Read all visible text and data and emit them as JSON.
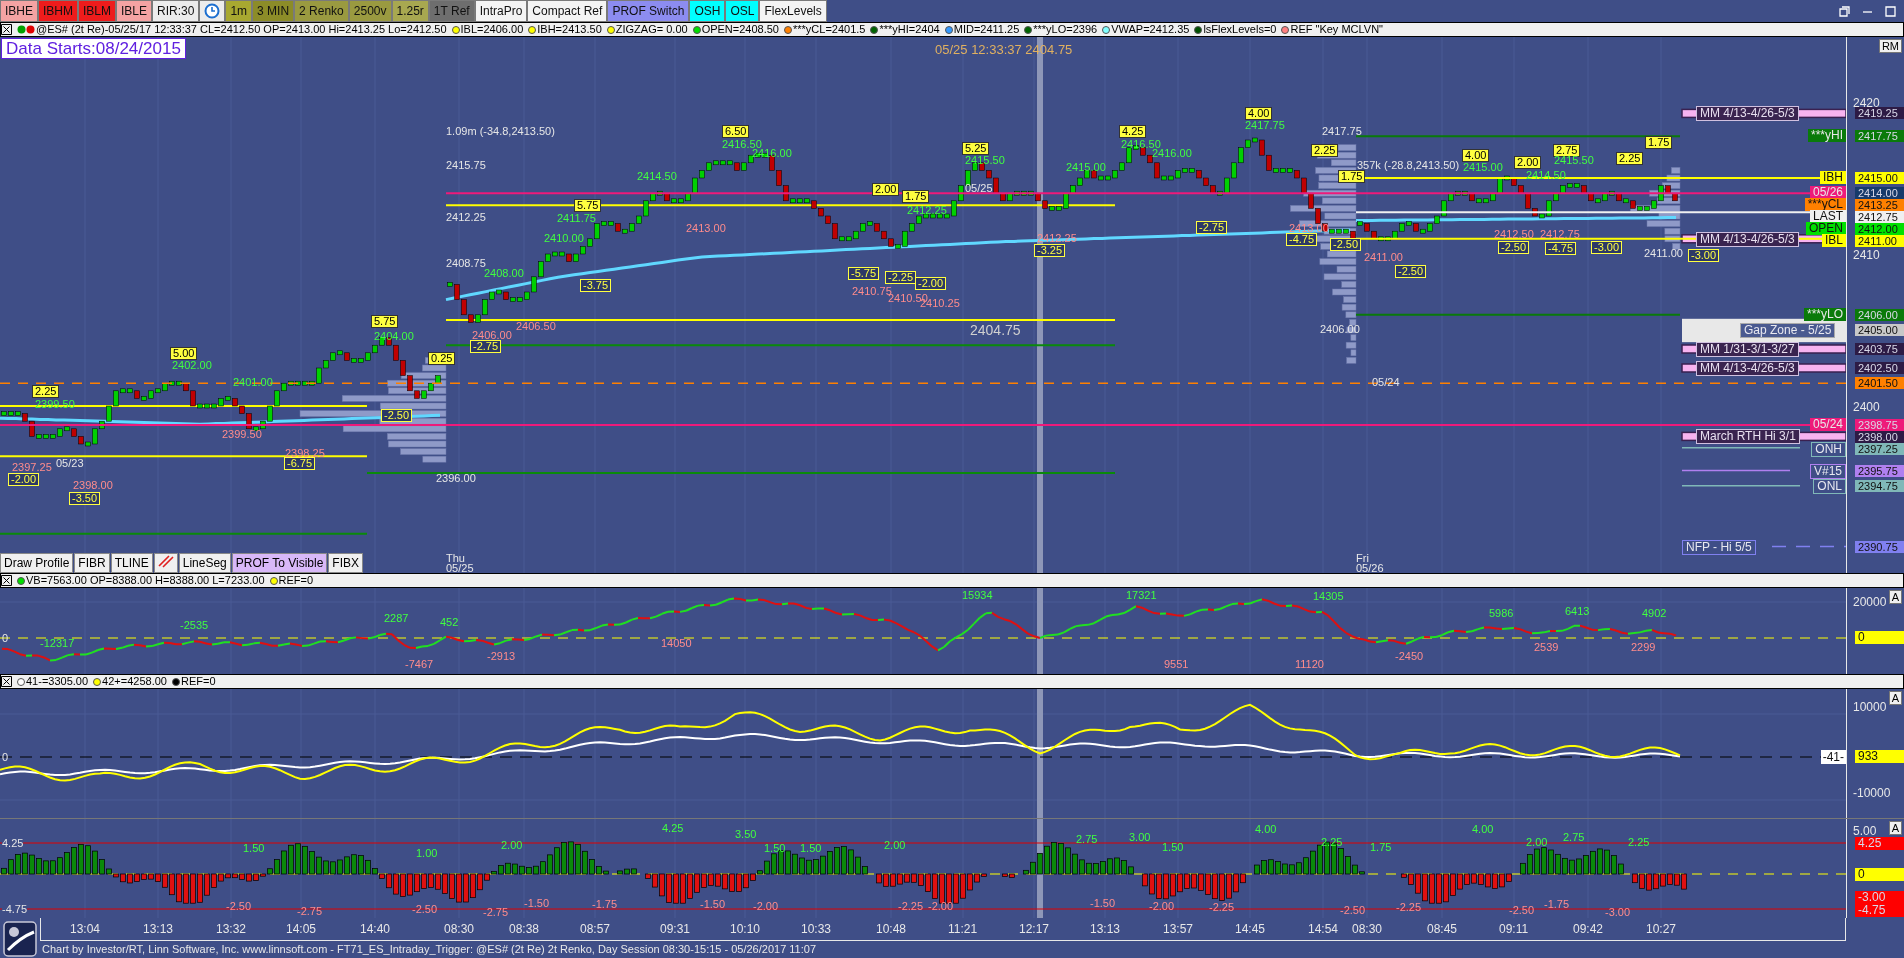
{
  "toolbar": {
    "buttons": [
      {
        "kind": "text",
        "label": "IBHE",
        "color": "#f4a3a3"
      },
      {
        "kind": "text",
        "label": "IBHM",
        "color": "#ee1c1c"
      },
      {
        "kind": "text",
        "label": "IBLM",
        "color": "#ee1c1c"
      },
      {
        "kind": "text",
        "label": "IBLE",
        "color": "#f4a3a3"
      },
      {
        "kind": "text",
        "label": "RIR:30",
        "color": "#ececec"
      },
      {
        "kind": "clock",
        "color": "#ececec"
      },
      {
        "kind": "text",
        "label": "1m",
        "color": "#a8a830"
      },
      {
        "kind": "text",
        "label": "3 MIN",
        "color": "#8c8c28"
      },
      {
        "kind": "text",
        "label": "2 Renko",
        "color": "#9a9a40"
      },
      {
        "kind": "text",
        "label": "2500v",
        "color": "#9a9a40"
      },
      {
        "kind": "text",
        "label": "1.25r",
        "color": "#a8a850"
      },
      {
        "kind": "text",
        "label": "1T Ref",
        "color": "#6e6e6e"
      },
      {
        "kind": "text",
        "label": "IntraPro",
        "color": "#f4f4f4"
      },
      {
        "kind": "text",
        "label": "Compact Ref",
        "color": "#f4f4f4"
      },
      {
        "kind": "text",
        "label": "PROF Switch",
        "color": "#8c8cf0"
      },
      {
        "kind": "text",
        "label": "OSH",
        "color": "#00ffff"
      },
      {
        "kind": "text",
        "label": "OSL",
        "color": "#00ffff"
      },
      {
        "kind": "text",
        "label": "FlexLevels",
        "color": "#f4f4f4"
      }
    ]
  },
  "price_chart": {
    "legend": {
      "title": "@ES# (2t Re)-05/25/17 12:33:37 CL=2412.50 OP=2413.00 Hi=2413.25 Lo=2412.50",
      "items": [
        {
          "text": "IBL=2406.00",
          "color": "#ffff00"
        },
        {
          "text": "IBH=2413.50",
          "color": "#ffff00"
        },
        {
          "text": "ZIGZAG= 0.00",
          "color": "#ffff00"
        },
        {
          "text": "OPEN=2408.50",
          "color": "#00e000"
        },
        {
          "text": "***yCL=2401.5",
          "color": "#ff8000"
        },
        {
          "text": "***yHI=2404",
          "color": "#006400"
        },
        {
          "text": "MID=2411.25",
          "color": "#3399ff"
        },
        {
          "text": "***yLO=2396",
          "color": "#006400"
        },
        {
          "text": "VWAP=2412.35",
          "color": "#80ffff"
        },
        {
          "text": "lsFlexLevels=0",
          "color": "#005000"
        },
        {
          "text": "REF \"Key MCLVN\"",
          "color": "#ff8080"
        }
      ]
    },
    "data_starts": "Data Starts:08/24/2015",
    "cursor_readout": "05/25 12:33:37 2404.75",
    "axis_button": "RM",
    "axis_ticks": [
      "2420",
      "2410",
      "2400"
    ],
    "date_labels": [
      {
        "day": "Thu",
        "date": "05/25"
      },
      {
        "day": "Fri",
        "date": "05/26"
      }
    ],
    "labels": [
      {
        "text": "1.09m (-34.8,2413.50)",
        "kind": "plain"
      },
      {
        "text": "2415.75",
        "kind": "plain"
      },
      {
        "text": "2412.25",
        "kind": "plain"
      },
      {
        "text": "2408.75",
        "kind": "plain"
      },
      {
        "text": "2417.75",
        "kind": "plain"
      },
      {
        "text": "357k (-28.8,2413.50)",
        "kind": "plain"
      },
      {
        "text": "2406.00",
        "kind": "plain"
      },
      {
        "text": "2396.00",
        "kind": "plain"
      },
      {
        "text": "2411.00",
        "kind": "plain"
      },
      {
        "text": "05/24",
        "kind": "plain"
      },
      {
        "text": "05/23",
        "kind": "plain"
      },
      {
        "text": "05/25",
        "kind": "plain"
      },
      {
        "text": "2404.75",
        "kind": "big"
      },
      {
        "text": "6.50",
        "kind": "box"
      },
      {
        "text": "5.25",
        "kind": "box"
      },
      {
        "text": "4.25",
        "kind": "box"
      },
      {
        "text": "4.00",
        "kind": "box"
      },
      {
        "text": "5.75",
        "kind": "box"
      },
      {
        "text": "2.00",
        "kind": "box"
      },
      {
        "text": "1.75",
        "kind": "box"
      },
      {
        "text": "2.25",
        "kind": "box"
      },
      {
        "text": "1.75",
        "kind": "box"
      },
      {
        "text": "4.00",
        "kind": "box"
      },
      {
        "text": "2.00",
        "kind": "box"
      },
      {
        "text": "2.75",
        "kind": "box"
      },
      {
        "text": "2.25",
        "kind": "box"
      },
      {
        "text": "1.75",
        "kind": "box"
      },
      {
        "text": "5.75",
        "kind": "box"
      },
      {
        "text": "0.25",
        "kind": "box"
      },
      {
        "text": "5.00",
        "kind": "box"
      },
      {
        "text": "2.25",
        "kind": "box"
      },
      {
        "text": "2416.50",
        "kind": "up"
      },
      {
        "text": "2416.00",
        "kind": "up"
      },
      {
        "text": "2415.50",
        "kind": "up"
      },
      {
        "text": "2416.50",
        "kind": "up"
      },
      {
        "text": "2416.00",
        "kind": "up"
      },
      {
        "text": "2417.75",
        "kind": "up"
      },
      {
        "text": "2415.00",
        "kind": "up"
      },
      {
        "text": "2414.50",
        "kind": "up"
      },
      {
        "text": "2411.75",
        "kind": "up"
      },
      {
        "text": "2410.00",
        "kind": "up"
      },
      {
        "text": "2408.00",
        "kind": "up"
      },
      {
        "text": "2404.00",
        "kind": "up"
      },
      {
        "text": "2402.00",
        "kind": "up"
      },
      {
        "text": "2401.00",
        "kind": "up"
      },
      {
        "text": "2399.50",
        "kind": "up"
      },
      {
        "text": "2415.00",
        "kind": "up"
      },
      {
        "text": "2414.50",
        "kind": "up"
      },
      {
        "text": "2415.50",
        "kind": "up"
      },
      {
        "text": "2412.25",
        "kind": "up"
      },
      {
        "text": "2413.00",
        "kind": "down"
      },
      {
        "text": "2410.75",
        "kind": "down"
      },
      {
        "text": "2410.50",
        "kind": "down"
      },
      {
        "text": "2410.25",
        "kind": "down"
      },
      {
        "text": "2412.25",
        "kind": "down"
      },
      {
        "text": "2406.00",
        "kind": "down"
      },
      {
        "text": "2406.50",
        "kind": "down"
      },
      {
        "text": "2399.50",
        "kind": "down"
      },
      {
        "text": "2398.25",
        "kind": "down"
      },
      {
        "text": "2397.25",
        "kind": "down"
      },
      {
        "text": "2398.00",
        "kind": "down"
      },
      {
        "text": "2411.00",
        "kind": "down"
      },
      {
        "text": "2412.50",
        "kind": "down"
      },
      {
        "text": "2412.75",
        "kind": "down"
      },
      {
        "text": "2413.00",
        "kind": "down"
      },
      {
        "text": "-3.75",
        "kind": "neg"
      },
      {
        "text": "-5.75",
        "kind": "neg"
      },
      {
        "text": "-2.25",
        "kind": "neg"
      },
      {
        "text": "-2.00",
        "kind": "neg"
      },
      {
        "text": "-3.25",
        "kind": "neg"
      },
      {
        "text": "-2.75",
        "kind": "neg"
      },
      {
        "text": "-4.75",
        "kind": "neg"
      },
      {
        "text": "-2.50",
        "kind": "neg"
      },
      {
        "text": "-2.50",
        "kind": "neg"
      },
      {
        "text": "-2.50",
        "kind": "neg"
      },
      {
        "text": "-4.75",
        "kind": "neg"
      },
      {
        "text": "-3.00",
        "kind": "neg"
      },
      {
        "text": "-3.00",
        "kind": "neg"
      },
      {
        "text": "-2.50",
        "kind": "neg"
      },
      {
        "text": "-6.75",
        "kind": "neg"
      },
      {
        "text": "-2.00",
        "kind": "neg"
      },
      {
        "text": "-3.50",
        "kind": "neg"
      },
      {
        "text": "-2.75",
        "kind": "neg"
      }
    ],
    "levels": [
      {
        "kind": "mm",
        "label": "MM 4/13-4/26-5/3",
        "color": "#f7b3f0",
        "tag": {
          "text": "2419.25",
          "color": "#2d1b45"
        }
      },
      {
        "kind": "flag",
        "label": "***yHI",
        "color": "#0a7a0a",
        "tag": {
          "text": "2417.75",
          "color": "#0a7a0a"
        }
      },
      {
        "kind": "flag",
        "label": "IBH",
        "color": "#ffff00",
        "tag": {
          "text": "2415.00",
          "color": "#ffff00"
        }
      },
      {
        "kind": "flag",
        "label": "05/26",
        "color": "#ee1a7a",
        "tag": {
          "text": "2414.00",
          "color": "#173a6a"
        }
      },
      {
        "kind": "flag",
        "label": "***yCL",
        "color": "#ff8000",
        "tag": {
          "text": "2413.25",
          "color": "#ff8000"
        }
      },
      {
        "kind": "flag",
        "label": "LAST",
        "color": "#f0f0f0",
        "tag": {
          "text": "2412.75",
          "color": "#f0f0f0"
        }
      },
      {
        "kind": "flag",
        "label": "OPEN",
        "color": "#00e000",
        "tag": {
          "text": "2412.00",
          "color": "#00e000"
        }
      },
      {
        "kind": "mm",
        "label": "MM 4/13-4/26-5/3",
        "color": "#f7b3f0"
      },
      {
        "kind": "flag",
        "label": "IBL",
        "color": "#ffff00",
        "tag": {
          "text": "2411.00",
          "color": "#ffff00"
        }
      },
      {
        "kind": "flag",
        "label": "***yLO",
        "color": "#0a7a0a",
        "tag": {
          "text": "2406.00",
          "color": "#0a7a0a"
        }
      },
      {
        "kind": "zone",
        "label": "Gap Zone - 5/25",
        "color": "#e8e8e8",
        "tag": {
          "text": "2405.00",
          "color": "#c8c8c8"
        }
      },
      {
        "kind": "mm",
        "label": "MM 1/31-3/1-3/27",
        "color": "#f7b3f0",
        "tag": {
          "text": "2403.75",
          "color": "#2d1b45"
        }
      },
      {
        "kind": "mm",
        "label": "MM 4/13-4/26-5/3",
        "color": "#f7b3f0",
        "tag": {
          "text": "2402.50",
          "color": "#2d1b45"
        }
      },
      {
        "kind": "dashed",
        "tag": {
          "text": "2401.50",
          "color": "#ff8000"
        }
      },
      {
        "kind": "flag",
        "label": "05/24",
        "color": "#ee1a7a",
        "tag": {
          "text": "2398.75",
          "color": "#ee1a7a"
        }
      },
      {
        "kind": "mm",
        "label": "March RTH Hi 3/1",
        "color": "#f7b3f0",
        "tag": {
          "text": "2398.00",
          "color": "#2d1b45"
        }
      },
      {
        "kind": "outline",
        "label": "ONH",
        "tag": {
          "text": "2397.25",
          "color": "#80b8b8"
        }
      },
      {
        "kind": "outline",
        "label": "V#15",
        "tag": {
          "text": "2395.75",
          "color": "#b080f0"
        }
      },
      {
        "kind": "outline",
        "label": "ONL",
        "tag": {
          "text": "2394.75",
          "color": "#80b8b8"
        }
      },
      {
        "kind": "nfp",
        "label": "NFP - Hi 5/5",
        "tag": {
          "text": "2390.75",
          "color": "#8080f0"
        }
      }
    ]
  },
  "drawing_toolbar": {
    "buttons": [
      {
        "kind": "text",
        "label": "Draw Profile",
        "color": "#f0f0f0"
      },
      {
        "kind": "text",
        "label": "FIBR",
        "color": "#f0f0f0"
      },
      {
        "kind": "text",
        "label": "TLINE",
        "color": "#f0f0f0"
      },
      {
        "kind": "pen",
        "color": "#f0f0f0"
      },
      {
        "kind": "text",
        "label": "LineSeg",
        "color": "#f0f0f0"
      },
      {
        "kind": "text",
        "label": "PROF To Visible",
        "color": "#d8b8f8"
      },
      {
        "kind": "text",
        "label": "FIBX",
        "color": "#f0f0f0"
      }
    ]
  },
  "volume_chart": {
    "legend": {
      "items": [
        {
          "text": "VB=7563.00 OP=8388.00 H=8388.00 L=7233.00",
          "color": "#00e000"
        },
        {
          "text": "REF=0",
          "color": "#ffff00"
        }
      ]
    },
    "zero_label": "0",
    "axis_button": "A",
    "axis_ticks": [
      "20000"
    ],
    "zero_tag": "0",
    "labels": [
      {
        "text": "-12317",
        "kind": "up"
      },
      {
        "text": "-2535",
        "kind": "up"
      },
      {
        "text": "2287",
        "kind": "up"
      },
      {
        "text": "452",
        "kind": "up"
      },
      {
        "text": "15934",
        "kind": "up"
      },
      {
        "text": "17321",
        "kind": "up"
      },
      {
        "text": "14305",
        "kind": "up"
      },
      {
        "text": "5986",
        "kind": "up"
      },
      {
        "text": "6413",
        "kind": "up"
      },
      {
        "text": "4902",
        "kind": "up"
      },
      {
        "text": "-7467",
        "kind": "down"
      },
      {
        "text": "-2913",
        "kind": "down"
      },
      {
        "text": "14050",
        "kind": "down"
      },
      {
        "text": "9551",
        "kind": "down"
      },
      {
        "text": "11120",
        "kind": "down"
      },
      {
        "text": "-2450",
        "kind": "down"
      },
      {
        "text": "2539",
        "kind": "down"
      },
      {
        "text": "2299",
        "kind": "down"
      }
    ]
  },
  "oscillator_chart": {
    "legend": {
      "items": [
        {
          "text": "41-=3305.00",
          "color": "#ffffff"
        },
        {
          "text": "42+=4258.00",
          "color": "#ffff00"
        },
        {
          "text": "REF=0",
          "color": "#000000"
        }
      ]
    },
    "zero_label": "0",
    "axis_button": "A",
    "axis_ticks": [
      "10000",
      "-10000"
    ],
    "series_tag": "-41-",
    "value_tag": "933"
  },
  "histogram_chart": {
    "left_labels": [
      "4.25",
      "-4.75"
    ],
    "axis_button": "A",
    "axis_ticks": [
      "5.00"
    ],
    "tags": [
      {
        "text": "4.25",
        "color": "#ff0000"
      },
      {
        "text": "0",
        "color": "#ffff00"
      },
      {
        "text": "-3.00",
        "color": "#ff0000"
      },
      {
        "text": "-4.75",
        "color": "#ff0000"
      }
    ],
    "labels": [
      {
        "text": "1.50",
        "kind": "up"
      },
      {
        "text": "1.00",
        "kind": "up"
      },
      {
        "text": "2.00",
        "kind": "up"
      },
      {
        "text": "4.25",
        "kind": "up"
      },
      {
        "text": "3.50",
        "kind": "up"
      },
      {
        "text": "1.50",
        "kind": "up"
      },
      {
        "text": "1.50",
        "kind": "up"
      },
      {
        "text": "2.00",
        "kind": "up"
      },
      {
        "text": "2.75",
        "kind": "up"
      },
      {
        "text": "3.00",
        "kind": "up"
      },
      {
        "text": "1.50",
        "kind": "up"
      },
      {
        "text": "4.00",
        "kind": "up"
      },
      {
        "text": "2.25",
        "kind": "up"
      },
      {
        "text": "1.75",
        "kind": "up"
      },
      {
        "text": "4.00",
        "kind": "up"
      },
      {
        "text": "2.00",
        "kind": "up"
      },
      {
        "text": "2.75",
        "kind": "up"
      },
      {
        "text": "2.25",
        "kind": "up"
      },
      {
        "text": "-2.50",
        "kind": "down"
      },
      {
        "text": "-2.75",
        "kind": "down"
      },
      {
        "text": "-2.50",
        "kind": "down"
      },
      {
        "text": "-2.75",
        "kind": "down"
      },
      {
        "text": "-1.50",
        "kind": "down"
      },
      {
        "text": "-1.75",
        "kind": "down"
      },
      {
        "text": "-1.50",
        "kind": "down"
      },
      {
        "text": "-2.00",
        "kind": "down"
      },
      {
        "text": "-2.25",
        "kind": "down"
      },
      {
        "text": "-2.00",
        "kind": "down"
      },
      {
        "text": "-1.50",
        "kind": "down"
      },
      {
        "text": "-2.00",
        "kind": "down"
      },
      {
        "text": "-2.25",
        "kind": "down"
      },
      {
        "text": "-2.50",
        "kind": "down"
      },
      {
        "text": "-2.25",
        "kind": "down"
      },
      {
        "text": "-2.50",
        "kind": "down"
      },
      {
        "text": "-1.75",
        "kind": "down"
      },
      {
        "text": "-3.00",
        "kind": "down"
      }
    ]
  },
  "time_axis": [
    "13:04",
    "13:13",
    "13:32",
    "14:05",
    "14:40",
    "08:30",
    "08:38",
    "08:57",
    "09:31",
    "10:10",
    "10:33",
    "10:48",
    "11:21",
    "12:17",
    "13:13",
    "13:57",
    "14:45",
    "14:54",
    "08:30",
    "08:45",
    "09:11",
    "09:42",
    "10:27"
  ],
  "footer": "Chart by Investor/RT, Linn Software, Inc. www.linnsoft.com - FT71_ES_Intraday_Trigger: @ES# (2t Re) 2t Renko, Day Session 08:30-15:15 - 05/26/2017 11:07"
}
